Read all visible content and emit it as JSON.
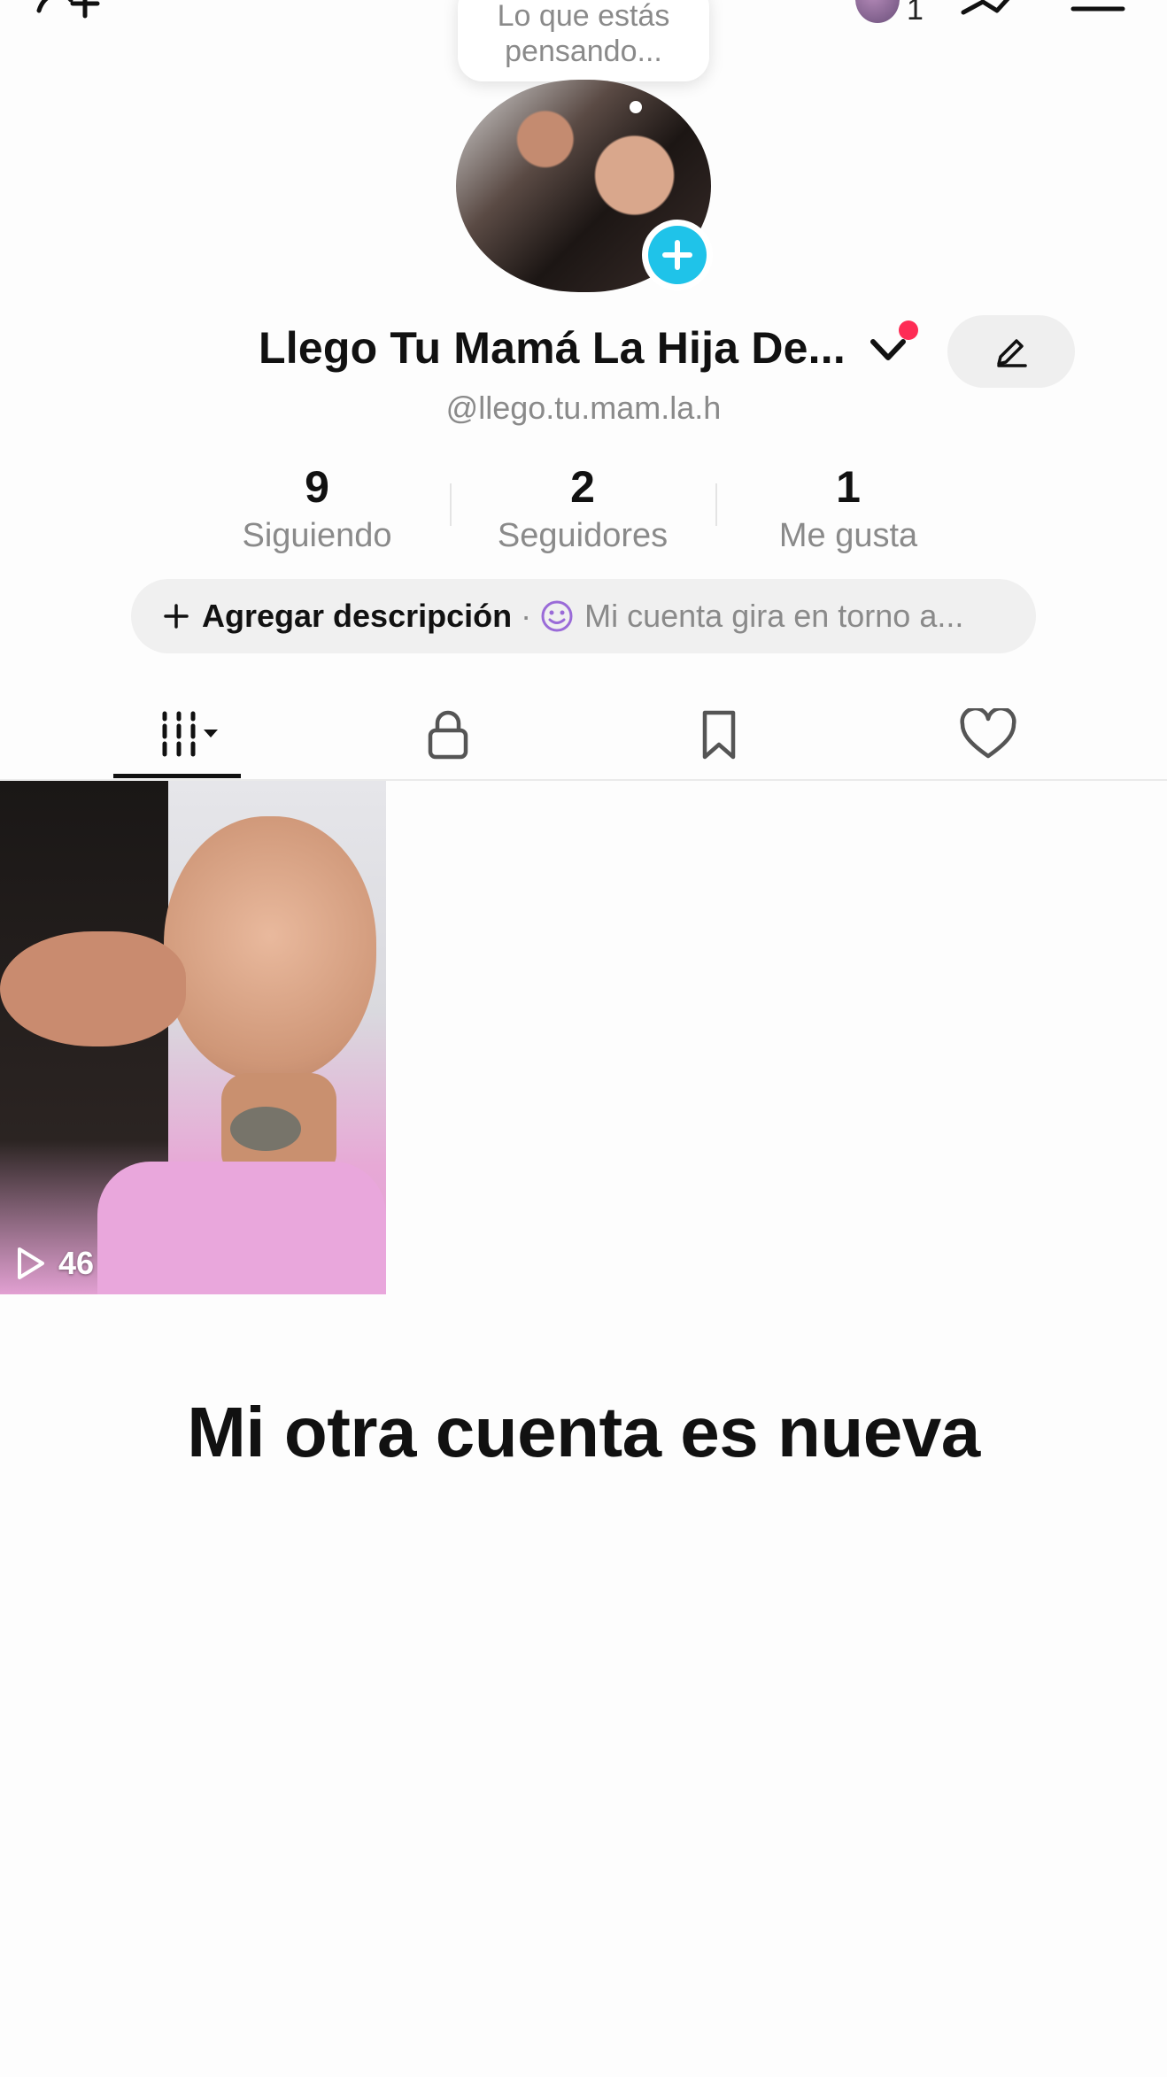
{
  "header": {
    "add_friend_icon": "person-add-icon",
    "notification_count": "1",
    "menu_icon": "hamburger-icon"
  },
  "thought_bubble": {
    "line1": "Lo que estás",
    "line2": "pensando..."
  },
  "profile": {
    "display_name": "Llego Tu Mamá La Hija De...",
    "username": "@llego.tu.mam.la.h",
    "accent_color": "#1fc3e9",
    "alert_color": "#fe2c55"
  },
  "stats": [
    {
      "value": "9",
      "label": "Siguiendo"
    },
    {
      "value": "2",
      "label": "Seguidores"
    },
    {
      "value": "1",
      "label": "Me gusta"
    }
  ],
  "description": {
    "add_label": "Agregar descripción",
    "separator": "·",
    "hint": "Mi cuenta gira en torno a..."
  },
  "tabs": [
    {
      "name": "videos",
      "icon": "grid-icon"
    },
    {
      "name": "private",
      "icon": "lock-icon"
    },
    {
      "name": "saved",
      "icon": "bookmark-icon"
    },
    {
      "name": "liked",
      "icon": "heart-icon"
    }
  ],
  "videos": [
    {
      "views": "46"
    }
  ],
  "caption": "Mi otra cuenta es nueva"
}
